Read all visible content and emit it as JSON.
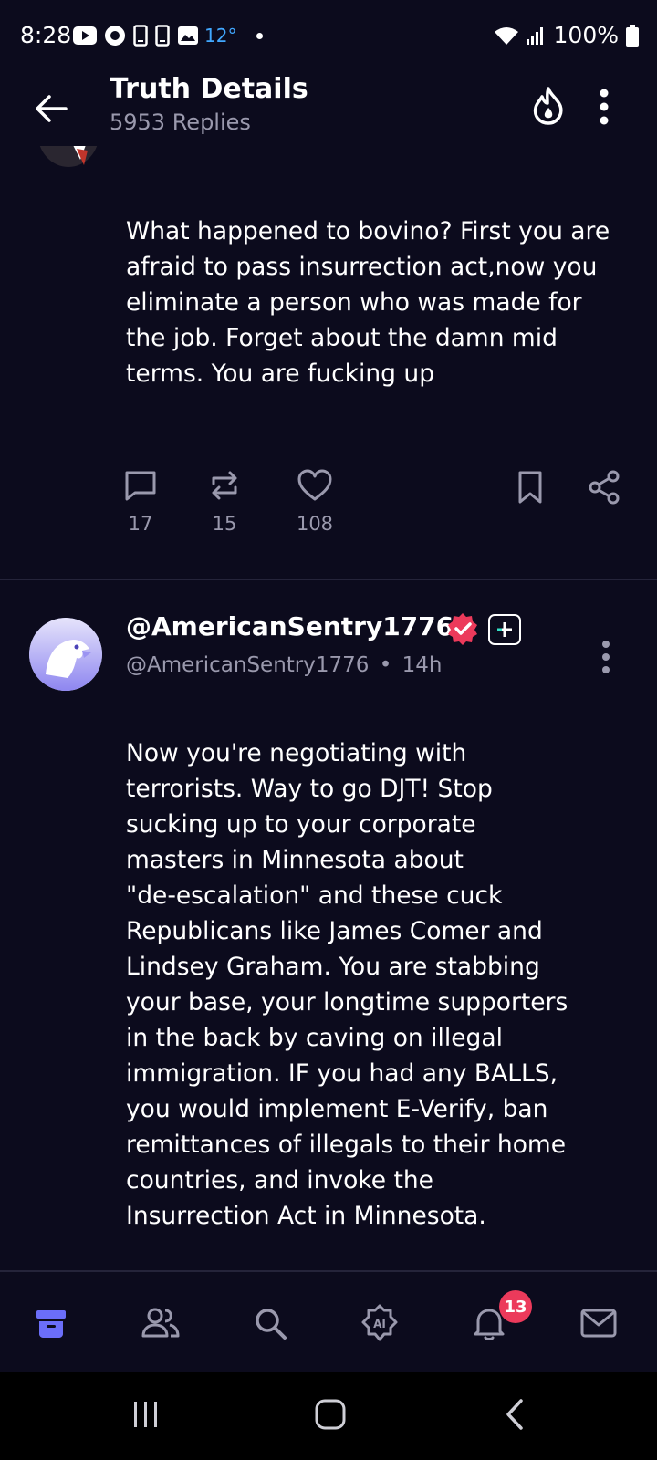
{
  "status_bar": {
    "time": "8:28",
    "temperature": "12°",
    "battery": "100%",
    "icons": [
      "youtube-icon",
      "circle-app-icon",
      "phone-icon",
      "phone-icon",
      "image-icon",
      "wifi-icon",
      "signal-icon",
      "battery-icon"
    ]
  },
  "header": {
    "title": "Truth Details",
    "subtitle": "5953 Replies",
    "icons": [
      "back-arrow-icon",
      "flame-icon",
      "more-vertical-icon"
    ]
  },
  "posts": [
    {
      "text": "What happened to bovino? First you are afraid to pass insurrection act,now you eliminate a person who was made for the job. Forget about the damn mid terms. You are fucking up",
      "counts": {
        "replies": "17",
        "retruths": "15",
        "likes": "108"
      }
    },
    {
      "display_name": "@AmericanSentry1776",
      "handle": "@AmericanSentry1776",
      "separator": "•",
      "time": "14h",
      "text_lines": [
        "Now you're negotiating with",
        "terrorists. Way to go DJT! Stop",
        "sucking up to your corporate",
        "masters in Minnesota about",
        "\"de-escalation\" and these cuck",
        "Republicans like James Comer and",
        "Lindsey Graham. You are stabbing",
        "your base, your longtime supporters",
        "in the back by caving on illegal",
        "immigration. IF you had any BALLS,",
        "you would implement E-Verify, ban",
        "remittances of illegals to their home",
        "countries, and invoke the",
        "Insurrection Act in Minnesota."
      ]
    }
  ],
  "bottom_nav": {
    "items": [
      "home-icon",
      "groups-icon",
      "search-icon",
      "ai-icon",
      "notifications-icon",
      "messages-icon"
    ],
    "notification_badge": "13"
  },
  "colors": {
    "background": "#0c0b1d",
    "accent": "#6b6ef9",
    "muted": "#9a99ad",
    "badge": "#ec3a5b"
  }
}
